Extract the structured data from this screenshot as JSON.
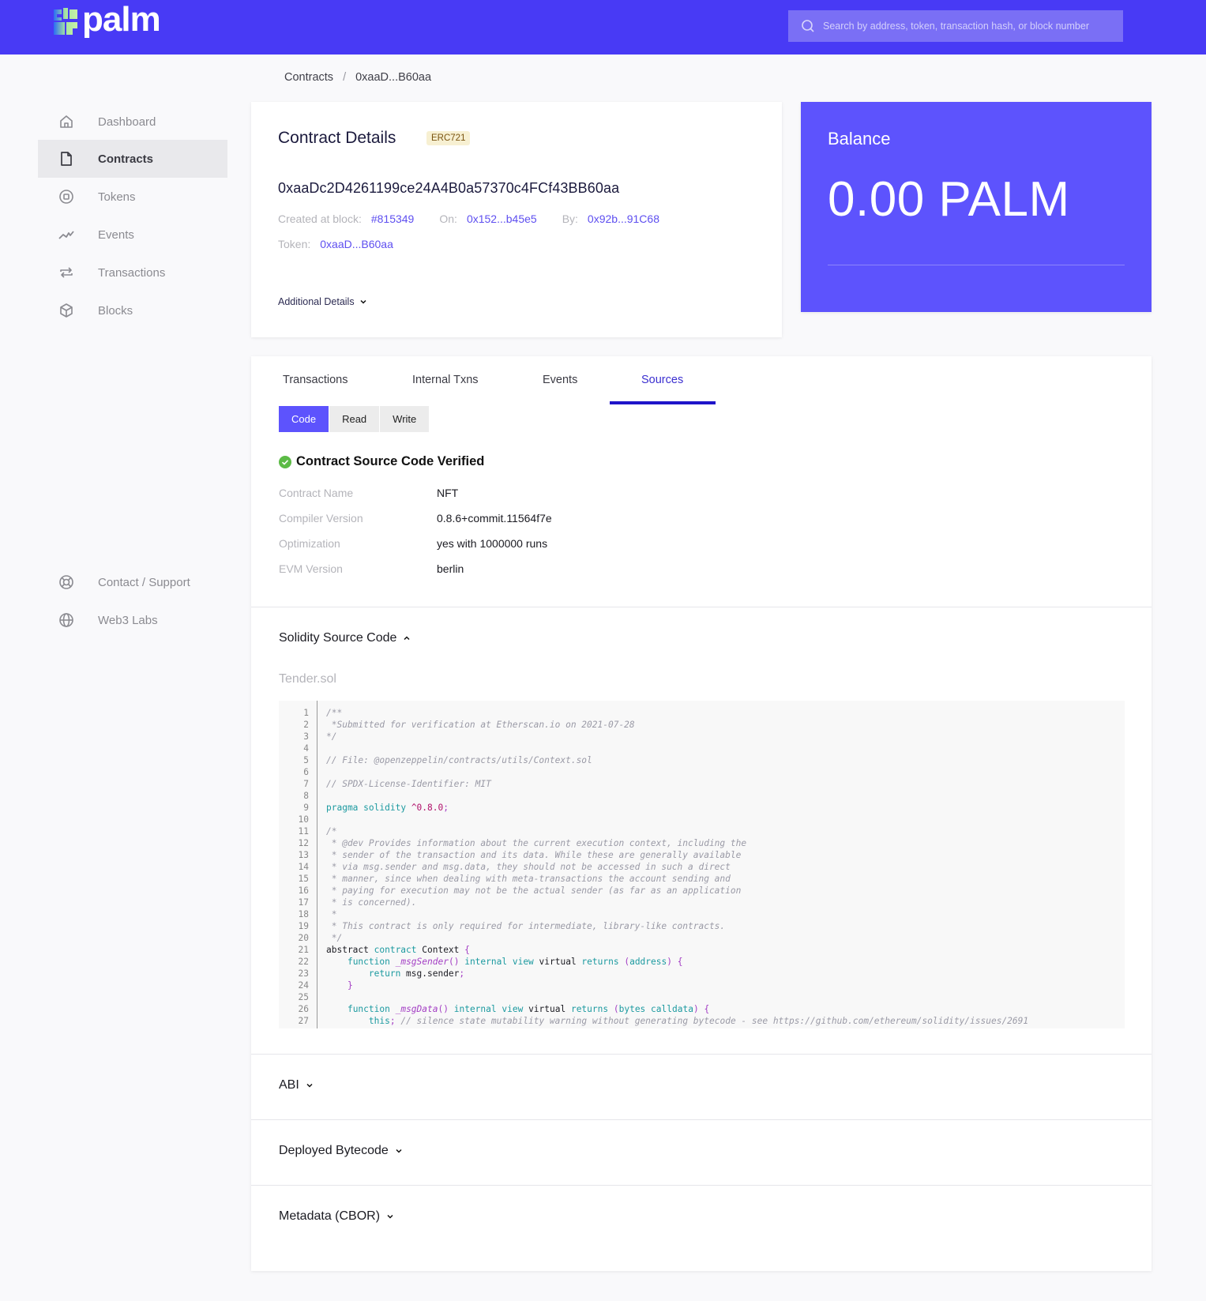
{
  "header": {
    "brand": "palm",
    "search_placeholder": "Search by address, token, transaction hash, or block number",
    "brand_color": "#483af5"
  },
  "sidebar": {
    "items": [
      {
        "label": "Dashboard",
        "icon": "home-icon",
        "active": false
      },
      {
        "label": "Contracts",
        "icon": "file-icon",
        "active": true
      },
      {
        "label": "Tokens",
        "icon": "token-icon",
        "active": false
      },
      {
        "label": "Events",
        "icon": "activity-icon",
        "active": false
      },
      {
        "label": "Transactions",
        "icon": "swap-icon",
        "active": false
      },
      {
        "label": "Blocks",
        "icon": "cube-icon",
        "active": false
      }
    ],
    "footer_items": [
      {
        "label": "Contact / Support",
        "icon": "lifebuoy-icon"
      },
      {
        "label": "Web3 Labs",
        "icon": "globe-icon"
      }
    ]
  },
  "breadcrumb": {
    "items": [
      "Contracts",
      "0xaaD...B60aa"
    ],
    "separator": "/"
  },
  "contract": {
    "title": "Contract Details",
    "badge": "ERC721",
    "address": "0xaaDc2D4261199ce24A4B0a57370c4FCf43BB60aa",
    "created_label": "Created at block:",
    "created_block": "#815349",
    "on_label": "On:",
    "on_value": "0x152...b45e5",
    "by_label": "By:",
    "by_value": "0x92b...91C68",
    "token_label": "Token:",
    "token_value": "0xaaD...B60aa",
    "additional_details": "Additional Details"
  },
  "balance": {
    "label": "Balance",
    "value": "0.00 PALM"
  },
  "tabs": [
    {
      "label": "Transactions",
      "active": false
    },
    {
      "label": "Internal Txns",
      "active": false
    },
    {
      "label": "Events",
      "active": false
    },
    {
      "label": "Sources",
      "active": true
    }
  ],
  "source_tabs": [
    {
      "label": "Code",
      "active": true
    },
    {
      "label": "Read",
      "active": false
    },
    {
      "label": "Write",
      "active": false
    }
  ],
  "verification": {
    "title": "Contract Source Code Verified",
    "rows": [
      {
        "key": "Contract Name",
        "value": "NFT"
      },
      {
        "key": "Compiler Version",
        "value": "0.8.6+commit.11564f7e"
      },
      {
        "key": "Optimization",
        "value": "yes with 1000000 runs"
      },
      {
        "key": "EVM Version",
        "value": "berlin"
      }
    ]
  },
  "sections": {
    "solidity": "Solidity Source Code",
    "filename": "Tender.sol",
    "abi": "ABI",
    "bytecode": "Deployed Bytecode",
    "metadata": "Metadata (CBOR)"
  },
  "code_lines": [
    "/**",
    " *Submitted for verification at Etherscan.io on 2021-07-28",
    "*/",
    "",
    "// File: @openzeppelin/contracts/utils/Context.sol",
    "",
    "// SPDX-License-Identifier: MIT",
    "",
    "pragma solidity ^0.8.0;",
    "",
    "/*",
    " * @dev Provides information about the current execution context, including the",
    " * sender of the transaction and its data. While these are generally available",
    " * via msg.sender and msg.data, they should not be accessed in such a direct",
    " * manner, since when dealing with meta-transactions the account sending and",
    " * paying for execution may not be the actual sender (as far as an application",
    " * is concerned).",
    " *",
    " * This contract is only required for intermediate, library-like contracts.",
    " */",
    "abstract contract Context {",
    "    function _msgSender() internal view virtual returns (address) {",
    "        return msg.sender;",
    "    }",
    "",
    "    function _msgData() internal view virtual returns (bytes calldata) {",
    "        this; // silence state mutability warning without generating bytecode - see https://github.com/ethereum/solidity/issues/2691"
  ]
}
